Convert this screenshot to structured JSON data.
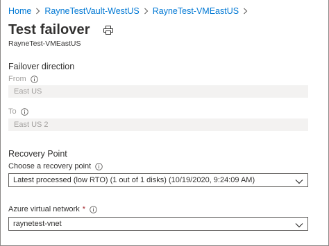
{
  "breadcrumb": {
    "items": [
      "Home",
      "RayneTestVault-WestUS",
      "RayneTest-VMEastUS"
    ]
  },
  "header": {
    "title": "Test failover",
    "subtitle": "RayneTest-VMEastUS",
    "print_icon": "print-icon"
  },
  "failover_direction": {
    "section_title": "Failover direction",
    "from_label": "From",
    "from_value": "East US",
    "to_label": "To",
    "to_value": "East US 2"
  },
  "recovery_point": {
    "section_title": "Recovery Point",
    "choose_label": "Choose a recovery point",
    "selected_value": "Latest processed (low RTO) (1 out of 1 disks) (10/19/2020, 9:24:09 AM)"
  },
  "network": {
    "label": "Azure virtual network",
    "required_marker": "*",
    "selected_value": "raynetest-vnet"
  },
  "colors": {
    "link": "#0078d4",
    "text": "#323130",
    "muted": "#a19f9d",
    "disabled_bg": "#f3f2f1",
    "required": "#a4262c"
  }
}
